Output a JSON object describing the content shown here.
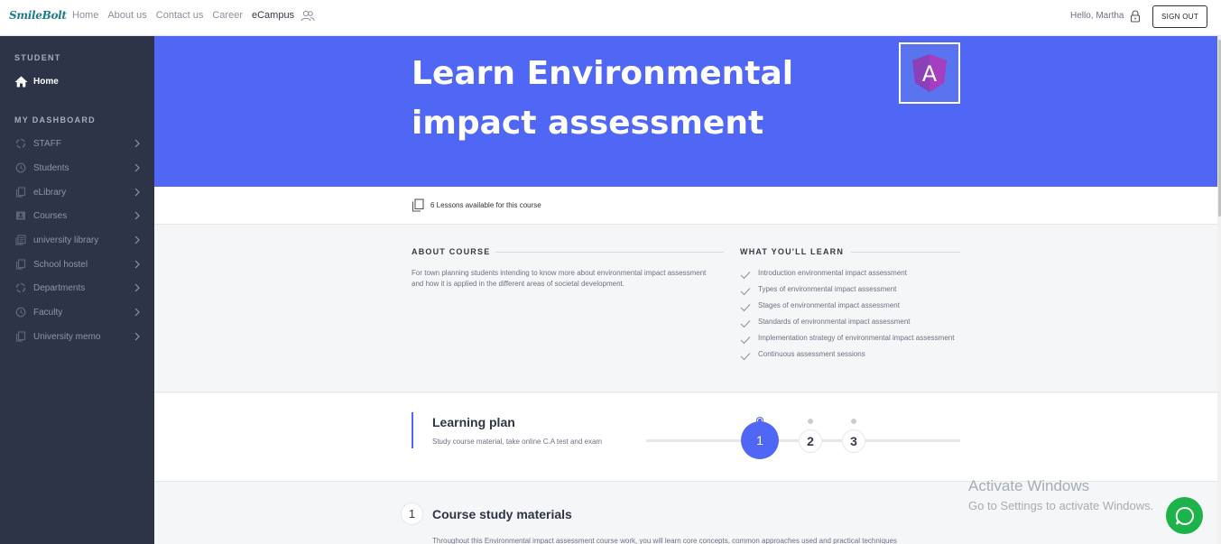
{
  "topnav": {
    "logo": "SmileBolt",
    "links": [
      "Home",
      "About us",
      "Contact us",
      "Career",
      "eCampus"
    ],
    "active_link": "eCampus",
    "greeting": "Hello, Martha",
    "sign_out": "SIGN OUT"
  },
  "sidebar": {
    "student_heading": "STUDENT",
    "home_label": "Home",
    "dashboard_heading": "MY DASHBOARD",
    "items": [
      {
        "label": "STAFF",
        "icon": "spinner-icon"
      },
      {
        "label": "Students",
        "icon": "clock-icon"
      },
      {
        "label": "eLibrary",
        "icon": "copy-icon"
      },
      {
        "label": "Courses",
        "icon": "id-card-icon"
      },
      {
        "label": "university library",
        "icon": "library-icon"
      },
      {
        "label": "School hostel",
        "icon": "copy-icon"
      },
      {
        "label": "Departments",
        "icon": "spinner-icon"
      },
      {
        "label": "Faculty",
        "icon": "clock-icon"
      },
      {
        "label": "University memo",
        "icon": "copy-icon"
      }
    ]
  },
  "hero": {
    "title": "Learn Environmental impact assessment",
    "badge_letter": "A"
  },
  "lessons": {
    "text": "6 Lessons available for this course"
  },
  "about": {
    "heading": "ABOUT COURSE",
    "description": "For town planning students intending to know more about environmental impact assessment and how it is applied in the different areas of societal development."
  },
  "learn": {
    "heading": "WHAT YOU'LL LEARN",
    "items": [
      "Introduction environmental impact assessment",
      "Types of environmental impact assessment",
      "Stages of environmental impact assessment",
      "Standards of environmental impact assessment",
      "Implementation strategy of environmental impact assessment",
      "Continuous assessment sessions"
    ]
  },
  "plan": {
    "title": "Learning plan",
    "subtitle": "Study course material, take online C.A test and exam",
    "steps": [
      "1",
      "2",
      "3"
    ],
    "active_step": 1
  },
  "materials": {
    "number": "1",
    "title": "Course study materials",
    "description": "Throughout this Environmental impact assessment course work, you will learn core concepts, common approaches used and practical techniques"
  },
  "watermark": {
    "title": "Activate Windows",
    "subtitle": "Go to Settings to activate Windows."
  },
  "colors": {
    "accent": "#5066f5",
    "sidebar": "#2e3447",
    "chat": "#1cb34a"
  }
}
